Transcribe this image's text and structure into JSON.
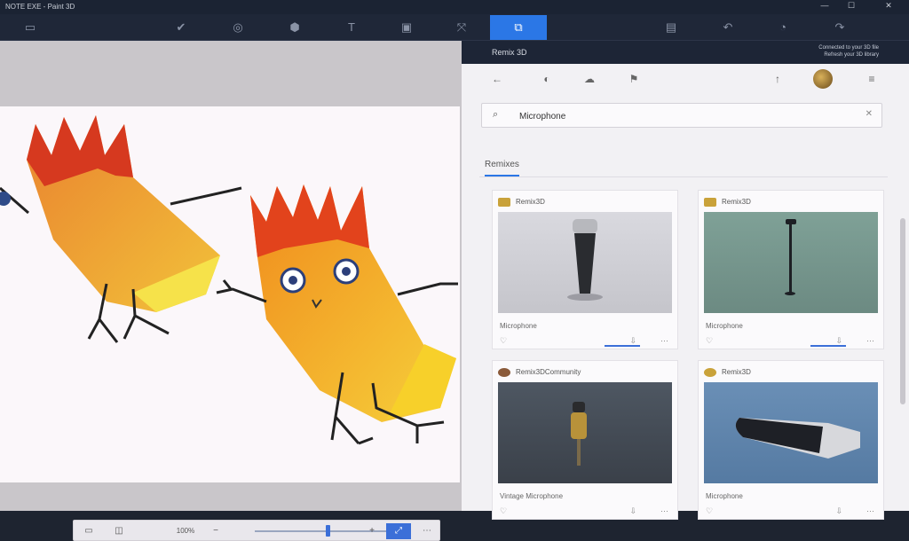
{
  "titlebar": {
    "title": "NOTE EXE - Paint 3D"
  },
  "window_controls": {
    "minimize": "—",
    "maximize": "☐",
    "close": "✕"
  },
  "toolbar": {
    "items": [
      {
        "name": "menu",
        "icon": "▭"
      },
      {
        "name": "brushes",
        "icon": "✔"
      },
      {
        "name": "2d-shapes",
        "icon": "◎"
      },
      {
        "name": "3d-shapes",
        "icon": "⬢"
      },
      {
        "name": "stickers",
        "icon": "T"
      },
      {
        "name": "text",
        "icon": "▣"
      },
      {
        "name": "canvas",
        "icon": "⤧"
      },
      {
        "name": "remix-3d",
        "icon": "⧉"
      }
    ],
    "right_items": [
      {
        "name": "paste",
        "icon": "▤"
      },
      {
        "name": "undo",
        "icon": "↶"
      },
      {
        "name": "history",
        "icon": "◔"
      },
      {
        "name": "redo",
        "icon": "↷"
      }
    ]
  },
  "panel": {
    "header_title": "Remix 3D",
    "header_info_1": "Connected to your 3D file",
    "header_info_2": "Refresh your 3D library",
    "search_value": "Microphone",
    "tab_label": "Remixes"
  },
  "cards": [
    {
      "author": "Remix3D",
      "title": "Microphone",
      "img": "mic1"
    },
    {
      "author": "Remix3D",
      "title": "Microphone",
      "img": "mic2"
    },
    {
      "author": "Remix3DCommunity",
      "title": "Vintage Microphone",
      "img": "mic3"
    },
    {
      "author": "Remix3D",
      "title": "Microphone",
      "img": "mic4"
    }
  ],
  "bottombar": {
    "zoom_label": "100%",
    "zoom_value": 0.55
  }
}
